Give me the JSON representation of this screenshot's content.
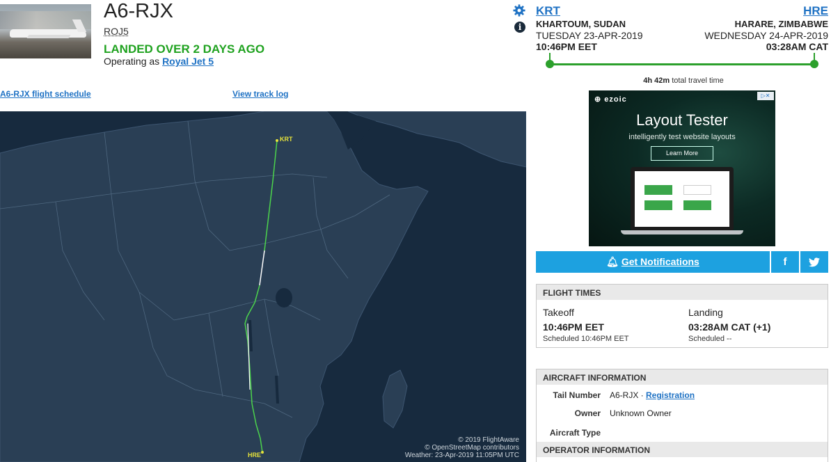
{
  "header": {
    "registration": "A6-RJX",
    "callsign": "ROJ5",
    "status": "LANDED OVER 2 DAYS AGO",
    "operating_prefix": "Operating as ",
    "operator_name": "Royal Jet 5"
  },
  "links": {
    "schedule": "A6-RJX flight schedule",
    "track_log": "View track log"
  },
  "map": {
    "origin_label": "KRT",
    "dest_label": "HRE",
    "credit_lines": [
      "© 2019 FlightAware",
      "© OpenStreetMap contributors",
      "Weather: 23-Apr-2019 11:05PM UTC"
    ]
  },
  "route": {
    "origin": {
      "code": "KRT",
      "city": "KHARTOUM, SUDAN",
      "date": "TUESDAY 23-APR-2019",
      "time": "10:46PM EET"
    },
    "destination": {
      "code": "HRE",
      "city": "HARARE, ZIMBABWE",
      "date": "WEDNESDAY 24-APR-2019",
      "time": "03:28AM CAT"
    },
    "travel_time_bold": "4h 42m",
    "travel_time_rest": " total travel time",
    "progress": 1.0,
    "color": "#2ca02c"
  },
  "ad": {
    "brand": "ezoic",
    "title": "Layout Tester",
    "subtitle": "intelligently test website layouts",
    "button": "Learn More"
  },
  "actions": {
    "notifications": "Get Notifications",
    "facebook": "f",
    "twitter": "🐦"
  },
  "flight_times": {
    "heading": "FLIGHT TIMES",
    "takeoff": {
      "label": "Takeoff",
      "time": "10:46PM EET",
      "scheduled": "Scheduled 10:46PM EET"
    },
    "landing": {
      "label": "Landing",
      "time": "03:28AM CAT (+1)",
      "scheduled": "Scheduled --"
    }
  },
  "aircraft_info": {
    "heading": "AIRCRAFT INFORMATION",
    "tail_label": "Tail Number",
    "tail_value": "A6-RJX",
    "tail_sep": " · ",
    "registration_link": "Registration",
    "owner_label": "Owner",
    "owner_value": "Unknown Owner",
    "type_label": "Aircraft Type"
  },
  "operator_info": {
    "heading": "OPERATOR INFORMATION"
  },
  "colors": {
    "link": "#1f72c4",
    "landed": "#1fa21f",
    "map_bg": "#172a3e",
    "land": "#2a3f55",
    "button": "#1da1e0"
  }
}
